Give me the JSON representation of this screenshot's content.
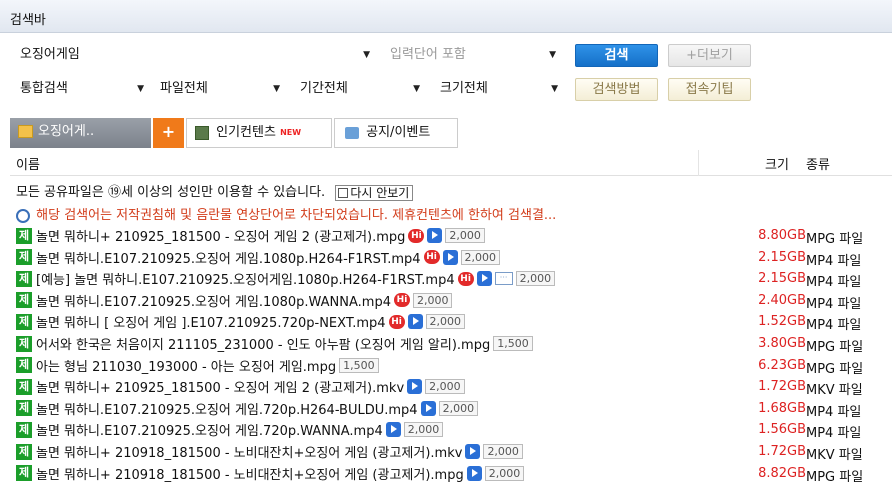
{
  "title": "검색바",
  "search": {
    "query": "오징어게임",
    "option_placeholder": "입력단어 포함",
    "search_label": "검색",
    "more_label": "+더보기",
    "filters": [
      "통합검색",
      "파일전체",
      "기간전체",
      "크기전체"
    ],
    "method_label": "검색방법",
    "tip_label": "접속기팁"
  },
  "tabs": {
    "active": "오징어게..",
    "add": "+",
    "popular": "인기컨텐츠",
    "popular_badge": "NEW",
    "notice": "공지/이벤트"
  },
  "columns": {
    "name": "이름",
    "size": "크기",
    "type": "종류"
  },
  "notices": {
    "adult": "모든 공유파일은 ⑲세 이상의 성인만 이용할 수 있습니다.",
    "hide_again": "다시 안보기",
    "blocked": "해당 검색어는 저작권침해 및 음란물 연상단어로 차단되었습니다. 제휴컨텐츠에 한하여 검색결..."
  },
  "badge_je": "제",
  "badge_hi": "Hi",
  "files": [
    {
      "name": "놀면 뭐하니+ 210925_181500 - 오징어 게임 2 (광고제거).mpg",
      "hi": true,
      "play": true,
      "comment": false,
      "points": "2,000",
      "size": "8.80GB",
      "type": "MPG 파일"
    },
    {
      "name": "놀면 뭐하니.E107.210925.오징어 게임.1080p.H264-F1RST.mp4",
      "hi": true,
      "play": true,
      "comment": false,
      "points": "2,000",
      "size": "2.15GB",
      "type": "MP4 파일"
    },
    {
      "name": "[예능] 놀면 뭐하니.E107.210925.오징어게임.1080p.H264-F1RST.mp4",
      "hi": true,
      "play": true,
      "comment": true,
      "points": "2,000",
      "size": "2.15GB",
      "type": "MP4 파일"
    },
    {
      "name": "놀면 뭐하니.E107.210925.오징어 게임.1080p.WANNA.mp4",
      "hi": true,
      "play": false,
      "comment": false,
      "points": "2,000",
      "size": "2.40GB",
      "type": "MP4 파일"
    },
    {
      "name": "놀면 뭐하니 [ 오징어 게임 ].E107.210925.720p-NEXT.mp4",
      "hi": true,
      "play": true,
      "comment": false,
      "points": "2,000",
      "size": "1.52GB",
      "type": "MP4 파일"
    },
    {
      "name": "어서와 한국은 처음이지 211105_231000 - 인도 아누팜 (오징어 게임 알리).mpg",
      "hi": false,
      "play": false,
      "comment": false,
      "points": "1,500",
      "size": "3.80GB",
      "type": "MPG 파일"
    },
    {
      "name": "아는 형님 211030_193000 - 아는 오징어 게임.mpg",
      "hi": false,
      "play": false,
      "comment": false,
      "points": "1,500",
      "size": "6.23GB",
      "type": "MPG 파일"
    },
    {
      "name": "놀면 뭐하니+ 210925_181500 - 오징어 게임 2 (광고제거).mkv",
      "hi": false,
      "play": true,
      "comment": false,
      "points": "2,000",
      "size": "1.72GB",
      "type": "MKV 파일"
    },
    {
      "name": "놀면 뭐하니.E107.210925.오징어 게임.720p.H264-BULDU.mp4",
      "hi": false,
      "play": true,
      "comment": false,
      "points": "2,000",
      "size": "1.68GB",
      "type": "MP4 파일"
    },
    {
      "name": "놀면 뭐하니.E107.210925.오징어 게임.720p.WANNA.mp4",
      "hi": false,
      "play": true,
      "comment": false,
      "points": "2,000",
      "size": "1.56GB",
      "type": "MP4 파일"
    },
    {
      "name": "놀면 뭐하니+ 210918_181500 - 노비대잔치+오징어 게임 (광고제거).mkv",
      "hi": false,
      "play": true,
      "comment": false,
      "points": "2,000",
      "size": "1.72GB",
      "type": "MKV 파일"
    },
    {
      "name": "놀면 뭐하니+ 210918_181500 - 노비대잔치+오징어 게임 (광고제거).mpg",
      "hi": false,
      "play": true,
      "comment": false,
      "points": "2,000",
      "size": "8.82GB",
      "type": "MPG 파일"
    }
  ],
  "colors": {
    "accent": "#1570c8",
    "je_badge": "#1b9e2a",
    "size_text": "#dd2222",
    "notice_text": "#d23c1a",
    "tab_add": "#f07a1a"
  }
}
